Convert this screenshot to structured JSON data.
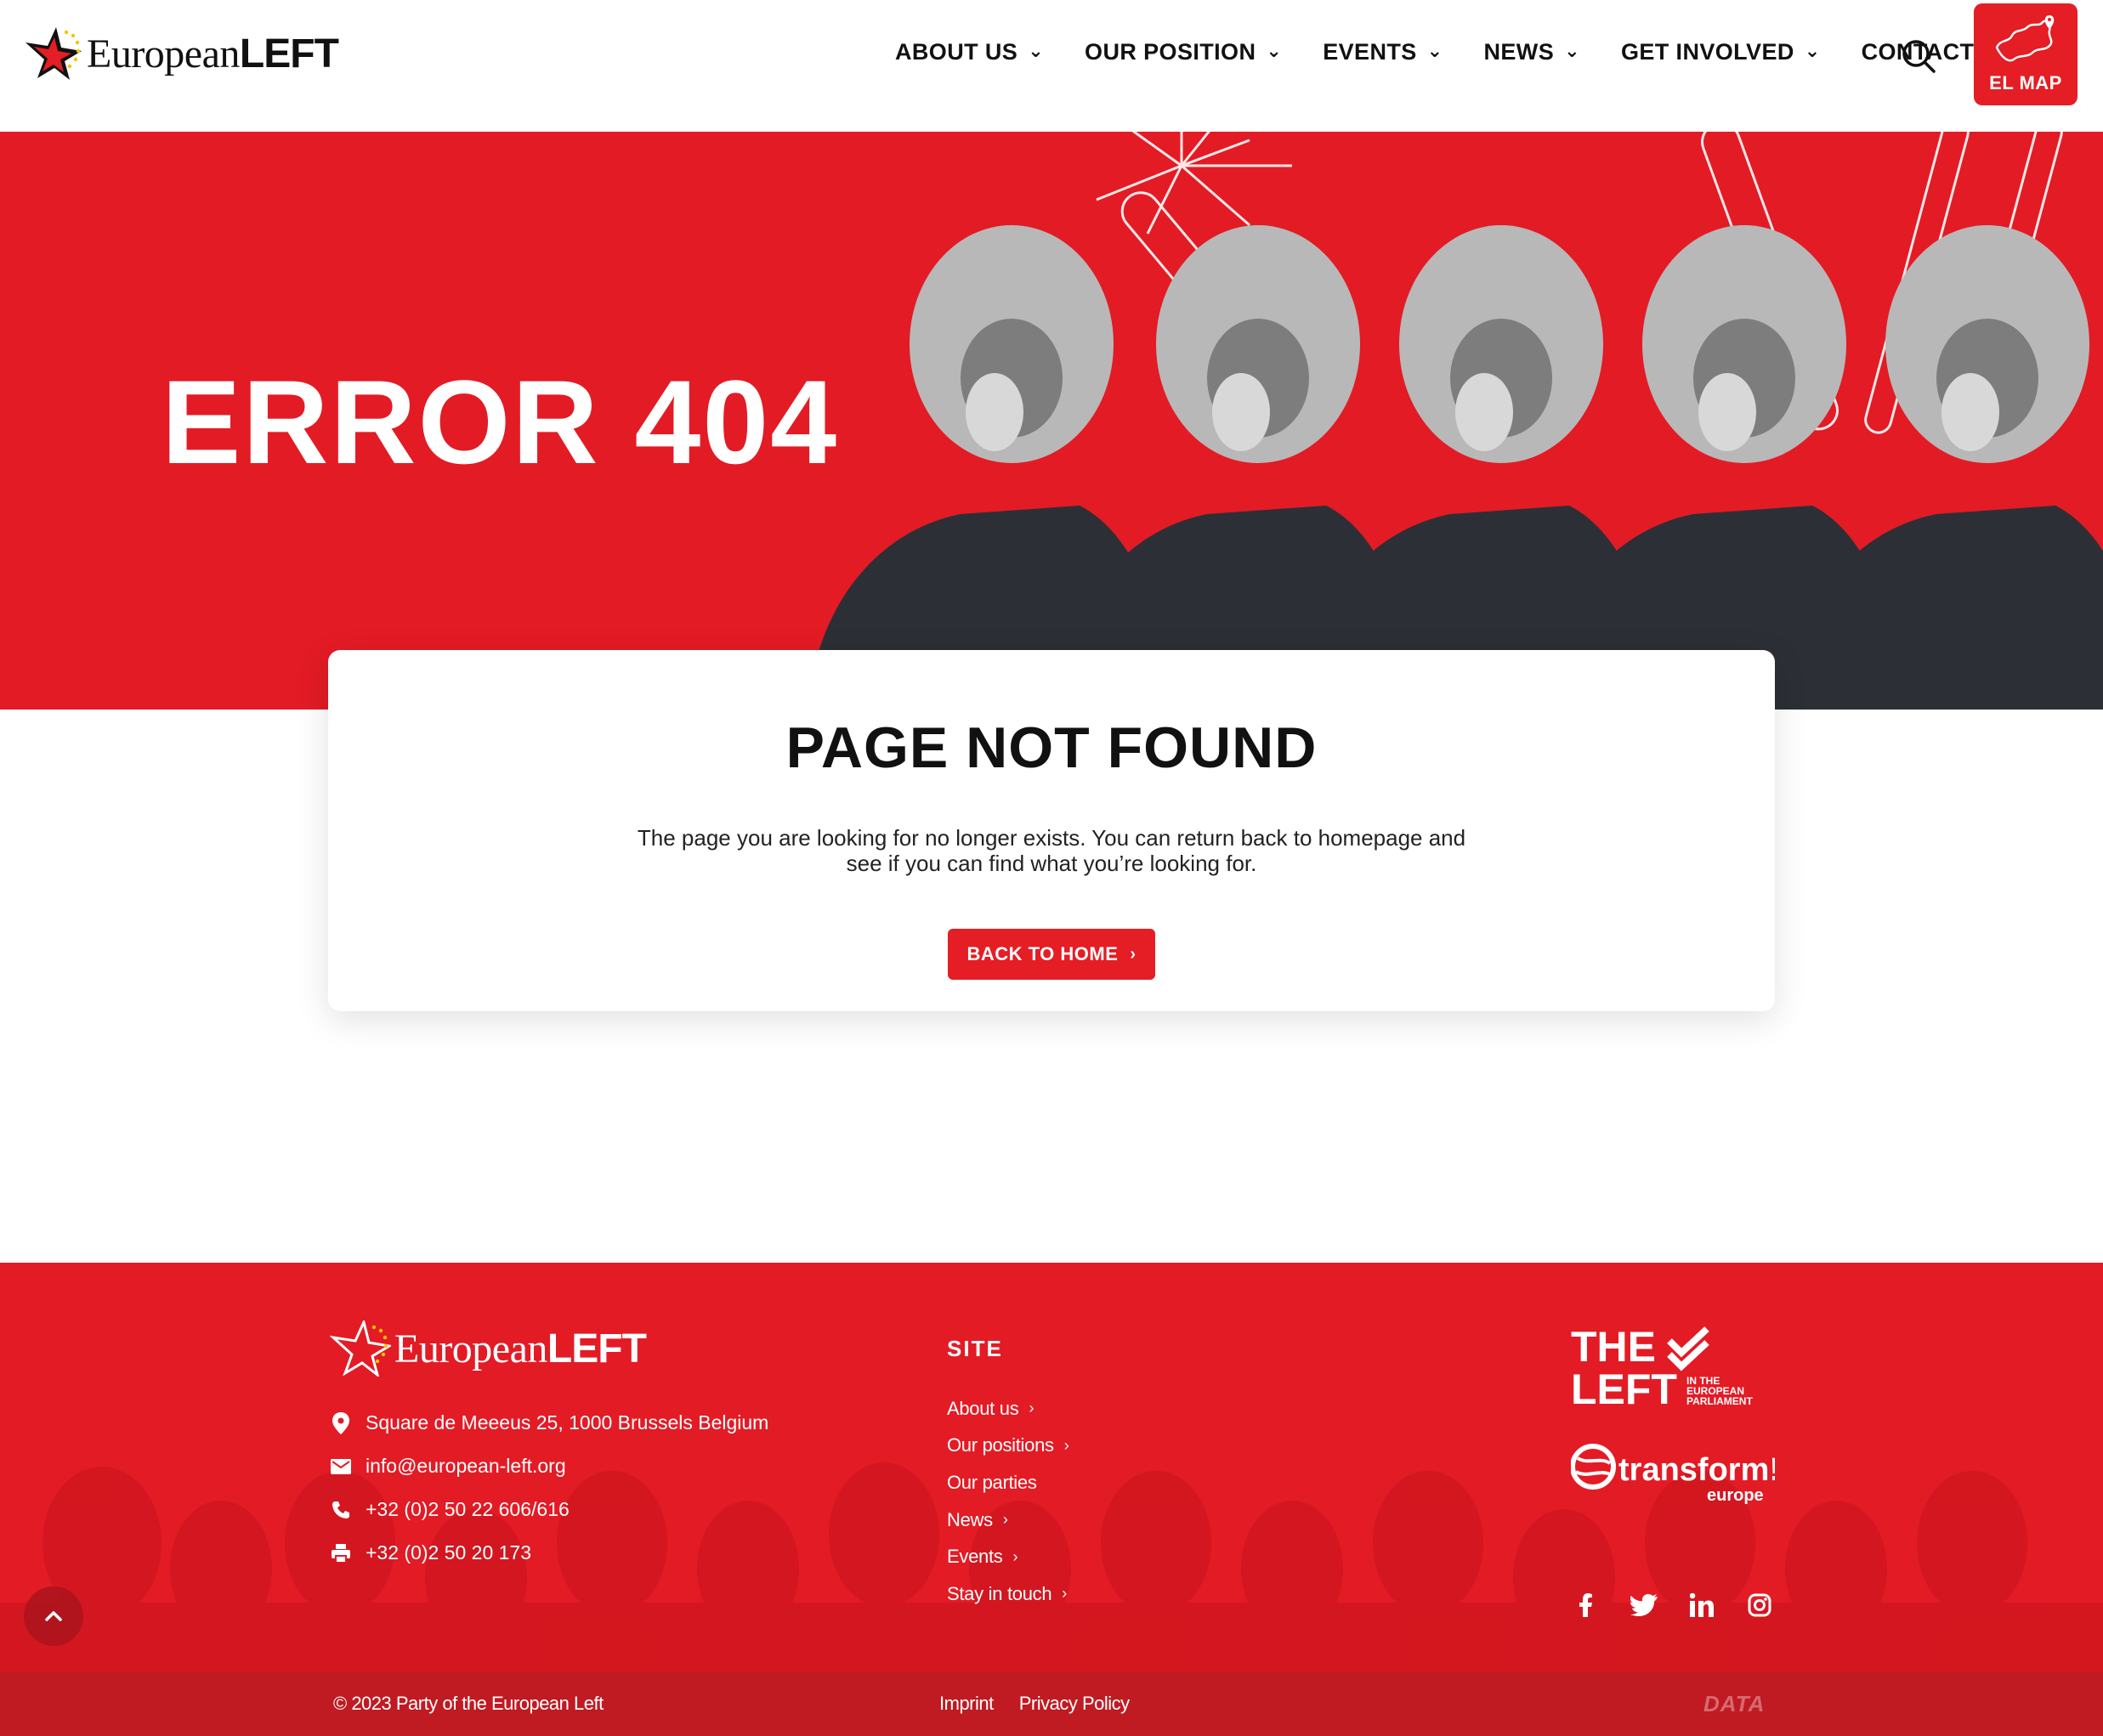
{
  "header": {
    "logo_regular": "European",
    "logo_bold": "LEFT",
    "nav": [
      {
        "label": "ABOUT US"
      },
      {
        "label": "OUR POSITION"
      },
      {
        "label": "EVENTS"
      },
      {
        "label": "NEWS"
      },
      {
        "label": "GET INVOLVED"
      },
      {
        "label": "CONTACT"
      }
    ],
    "map_button_label": "EL MAP"
  },
  "hero": {
    "title": "ERROR 404"
  },
  "card": {
    "title": "PAGE NOT FOUND",
    "text": "The page you are looking for no longer exists. You can return back to homepage and see if you can find what you’re looking for.",
    "button_label": "BACK TO HOME"
  },
  "footer": {
    "logo_regular": "European",
    "logo_bold": "LEFT",
    "contact": [
      {
        "icon": "location-pin-icon",
        "text": "Square de Meeeus 25, 1000 Brussels Belgium"
      },
      {
        "icon": "mail-icon",
        "text": "info@european-left.org"
      },
      {
        "icon": "phone-icon",
        "text": "+32 (0)2 50 22 606/616"
      },
      {
        "icon": "fax-icon",
        "text": "+32 (0)2 50 20 173"
      }
    ],
    "site_title": "SITE",
    "site_links": [
      {
        "label": "About us",
        "has_chevron": true
      },
      {
        "label": "Our positions",
        "has_chevron": true
      },
      {
        "label": "Our parties",
        "has_chevron": false
      },
      {
        "label": "News",
        "has_chevron": true
      },
      {
        "label": "Events",
        "has_chevron": true
      },
      {
        "label": "Stay in touch",
        "has_chevron": true
      }
    ],
    "partner1": {
      "line1": "THE",
      "line2": "LEFT",
      "sub": [
        "IN THE",
        "EUROPEAN",
        "PARLIAMENT"
      ]
    },
    "partner2": {
      "name": "transform!",
      "sub": "europe"
    },
    "socials": [
      "facebook-icon",
      "twitter-icon",
      "linkedin-icon",
      "instagram-icon"
    ],
    "copyright": "© 2023 Party of the European Left",
    "legal": [
      "Imprint",
      "Privacy Policy"
    ],
    "credit": "DATA"
  },
  "colors": {
    "brand_red": "#e31b25",
    "dark_red": "#c01a22",
    "text": "#111111"
  }
}
